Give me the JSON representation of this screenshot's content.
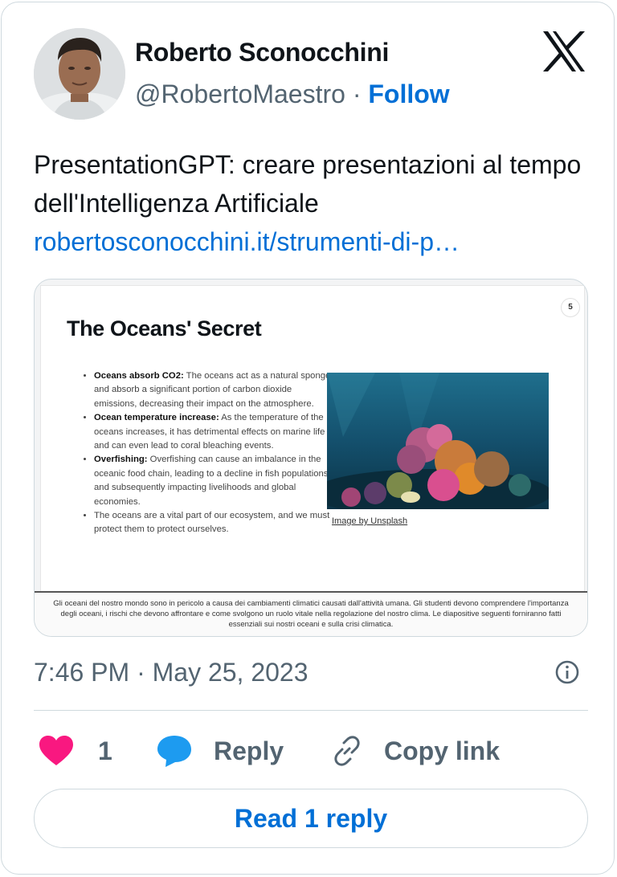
{
  "author": {
    "name": "Roberto Sconocchini",
    "handle": "@RobertoMaestro",
    "follow_label": "Follow",
    "separator": "·"
  },
  "tweet": {
    "text": "PresentationGPT: creare presentazioni al tempo dell'Intelligenza Artificiale",
    "link": "robertosconocchini.it/strumenti-di-p…",
    "timestamp": "7:46 PM · May 25, 2023"
  },
  "media": {
    "slide_number": "5",
    "slide_title": "The Oceans' Secret",
    "bullets": [
      {
        "head": "Oceans absorb CO2:",
        "body": " The oceans act as a natural sponge and absorb a significant portion of carbon dioxide emissions, decreasing their impact on the atmosphere."
      },
      {
        "head": "Ocean temperature increase:",
        "body": " As the temperature of the oceans increases, it has detrimental effects on marine life and can even lead to coral bleaching events."
      },
      {
        "head": "Overfishing:",
        "body": " Overfishing can cause an imbalance in the oceanic food chain, leading to a decline in fish populations, and subsequently impacting livelihoods and global economies."
      },
      {
        "head": "",
        "body": "The oceans are a vital part of our ecosystem, and we must protect them to protect ourselves."
      }
    ],
    "image_credit": "Image by Unsplash",
    "notes": "Gli oceani del nostro mondo sono in pericolo a causa dei cambiamenti climatici causati dall'attività umana. Gli studenti devono comprendere l'importanza degli oceani, i rischi che devono affrontare e come svolgono un ruolo vitale nella regolazione del nostro clima. Le diapositive seguenti forniranno fatti essenziali sui nostri oceani e sulla crisi climatica."
  },
  "actions": {
    "like_count": "1",
    "reply_label": "Reply",
    "copy_label": "Copy link",
    "read_replies_label": "Read 1 reply"
  },
  "colors": {
    "link_blue": "#006fd6",
    "heart_pink": "#f91880",
    "reply_bubble_blue": "#1d9bf0",
    "secondary_text": "#536471",
    "border": "#cfd9de"
  },
  "icons": {
    "platform_logo": "x-logo-icon",
    "like": "heart-icon",
    "reply": "speech-bubble-icon",
    "copy": "link-chain-icon",
    "info": "info-circle-icon"
  }
}
